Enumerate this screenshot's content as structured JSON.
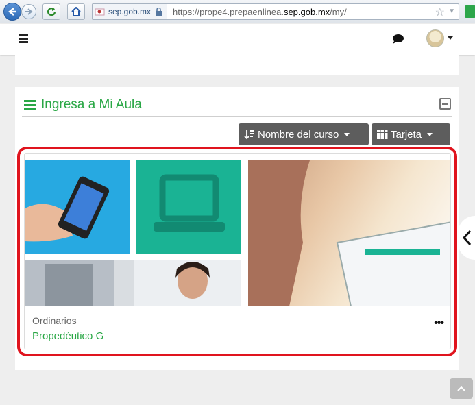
{
  "browser": {
    "site_identity": "sep.gob.mx",
    "url_prefix": "https://prope4.prepaenlinea.",
    "url_domain": "sep.gob.mx",
    "url_suffix": "/my/"
  },
  "block": {
    "title": "Ingresa a Mi Aula",
    "sort_button": "Nombre del curso",
    "view_button": "Tarjeta"
  },
  "course": {
    "category": "Ordinarios",
    "name": "Propedéutico G",
    "menu": "•••"
  },
  "colors": {
    "accent_green": "#29a745",
    "highlight_red": "#e0141e",
    "button_gray": "#5d5d5d"
  },
  "icons": [
    "back-icon",
    "forward-icon",
    "reload-icon",
    "home-icon",
    "lock-icon",
    "star-icon",
    "menu-icon",
    "chat-icon",
    "list-icon",
    "collapse-icon",
    "sort-icon",
    "grid-icon",
    "chevron-left-icon",
    "chevron-up-icon"
  ]
}
